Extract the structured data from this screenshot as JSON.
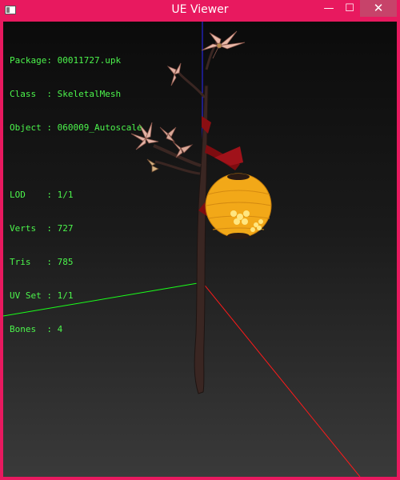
{
  "window": {
    "title": "UE Viewer",
    "accent": "#e8195f"
  },
  "controls": {
    "minimize": "—",
    "maximize": "☐",
    "close": "✕"
  },
  "info": {
    "package": "Package: 00011727.upk",
    "class": "Class  : SkeletalMesh",
    "object": "Object : 060009_Autoscale",
    "lod": "LOD    : 1/1",
    "verts": "Verts  : 727",
    "tris": "Tris   : 785",
    "uvset": "UV Set : 1/1",
    "bones": "Bones  : 4"
  },
  "axes": {
    "x_color": "#ff1a1a",
    "y_color": "#1aff1a",
    "z_color": "#2a2aff"
  }
}
